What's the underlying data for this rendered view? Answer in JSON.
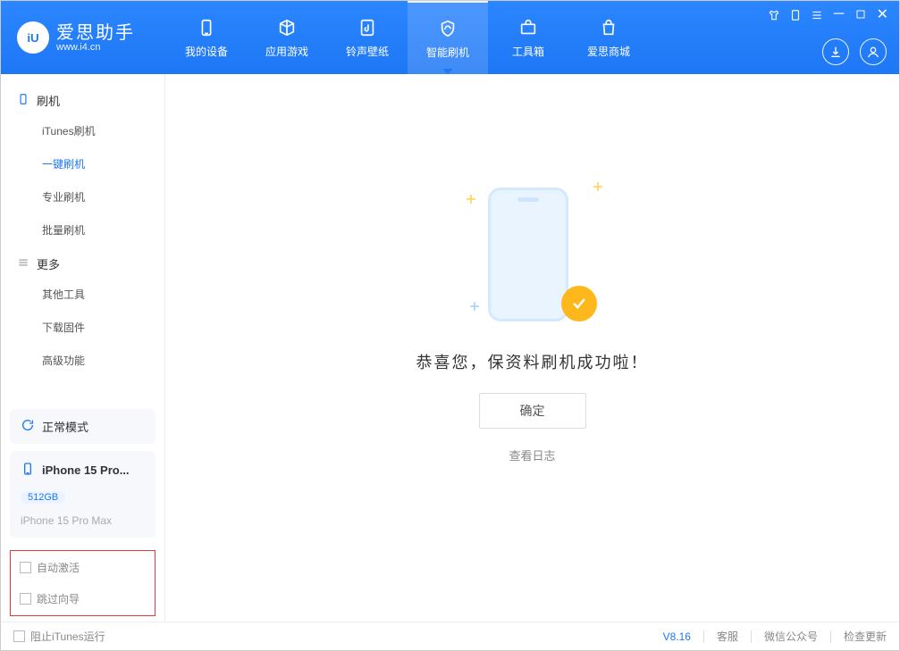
{
  "app": {
    "name": "爱思助手",
    "url": "www.i4.cn"
  },
  "nav": [
    {
      "label": "我的设备"
    },
    {
      "label": "应用游戏"
    },
    {
      "label": "铃声壁纸"
    },
    {
      "label": "智能刷机"
    },
    {
      "label": "工具箱"
    },
    {
      "label": "爱思商城"
    }
  ],
  "sidebar": {
    "group1_title": "刷机",
    "group1_items": [
      {
        "label": "iTunes刷机"
      },
      {
        "label": "一键刷机"
      },
      {
        "label": "专业刷机"
      },
      {
        "label": "批量刷机"
      }
    ],
    "group2_title": "更多",
    "group2_items": [
      {
        "label": "其他工具"
      },
      {
        "label": "下载固件"
      },
      {
        "label": "高级功能"
      }
    ],
    "mode_label": "正常模式",
    "device": {
      "title": "iPhone 15 Pro...",
      "storage": "512GB",
      "sub": "iPhone 15 Pro Max"
    }
  },
  "redbox": {
    "auto_activate": "自动激活",
    "skip_guide": "跳过向导"
  },
  "main": {
    "message": "恭喜您，保资料刷机成功啦！",
    "ok": "确定",
    "view_log": "查看日志"
  },
  "footer": {
    "block_itunes": "阻止iTunes运行",
    "version": "V8.16",
    "support": "客服",
    "wechat": "微信公众号",
    "check_update": "检查更新"
  }
}
